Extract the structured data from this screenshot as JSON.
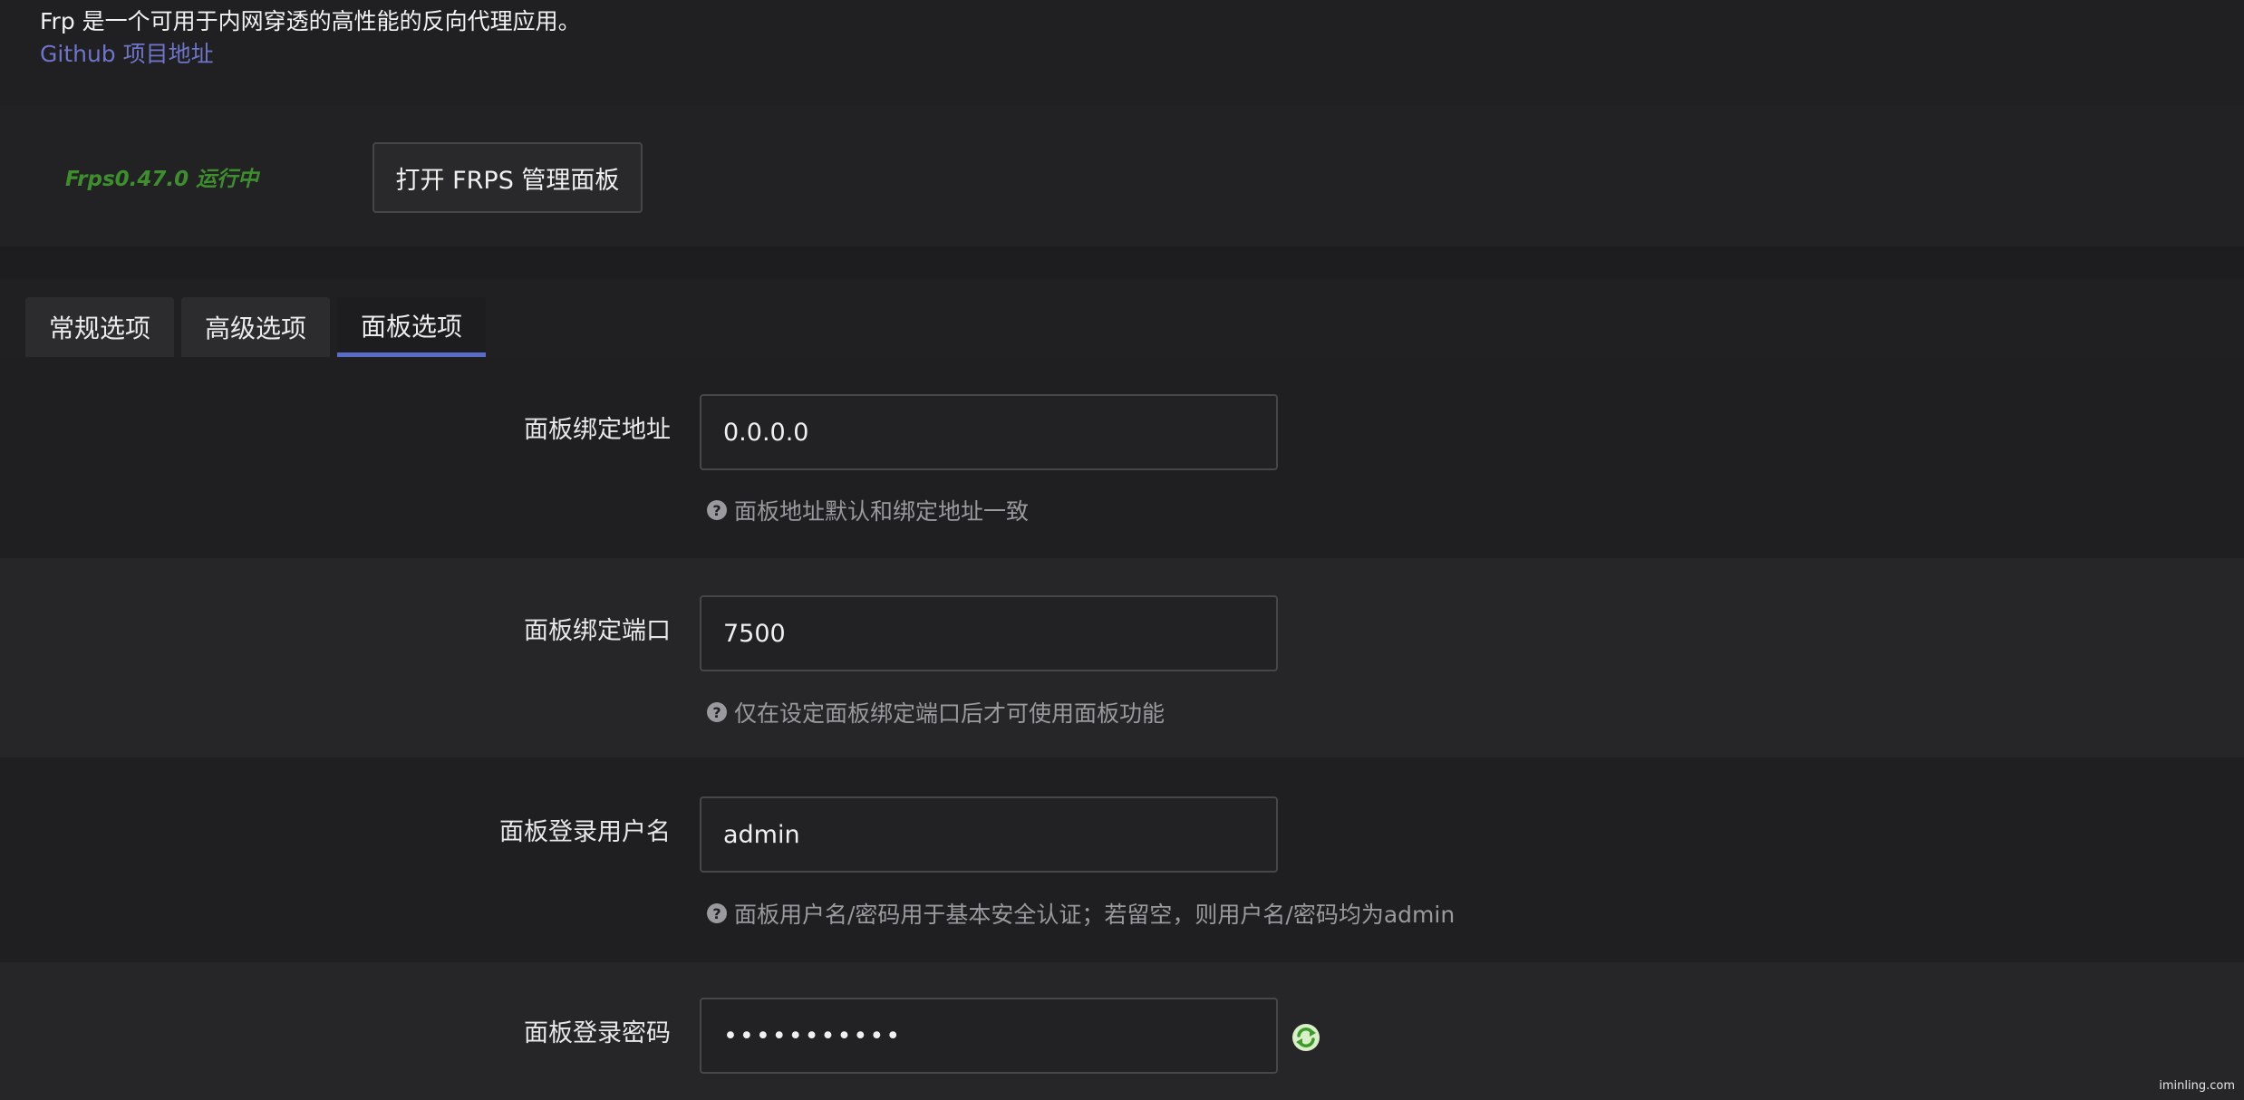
{
  "header": {
    "description": "Frp 是一个可用于内网穿透的高性能的反向代理应用。",
    "github_link": "Github 项目地址"
  },
  "status": {
    "running_text": "Frps0.47.0 运行中",
    "open_panel_button": "打开 FRPS 管理面板",
    "running_color": "#3e8e2e"
  },
  "tabs": [
    {
      "label": "常规选项",
      "active": false
    },
    {
      "label": "高级选项",
      "active": false
    },
    {
      "label": "面板选项",
      "active": true
    }
  ],
  "fields": [
    {
      "label": "面板绑定地址",
      "value": "0.0.0.0",
      "hint": "面板地址默认和绑定地址一致"
    },
    {
      "label": "面板绑定端口",
      "value": "7500",
      "hint": "仅在设定面板绑定端口后才可使用面板功能"
    },
    {
      "label": "面板登录用户名",
      "value": "admin",
      "hint": "面板用户名/密码用于基本安全认证；若留空，则用户名/密码均为admin"
    },
    {
      "label": "面板登录密码",
      "value": "•••••••••••"
    }
  ],
  "accent_color": "#5b6bc8",
  "link_color": "#6f74c9",
  "watermark": "iminling.com"
}
